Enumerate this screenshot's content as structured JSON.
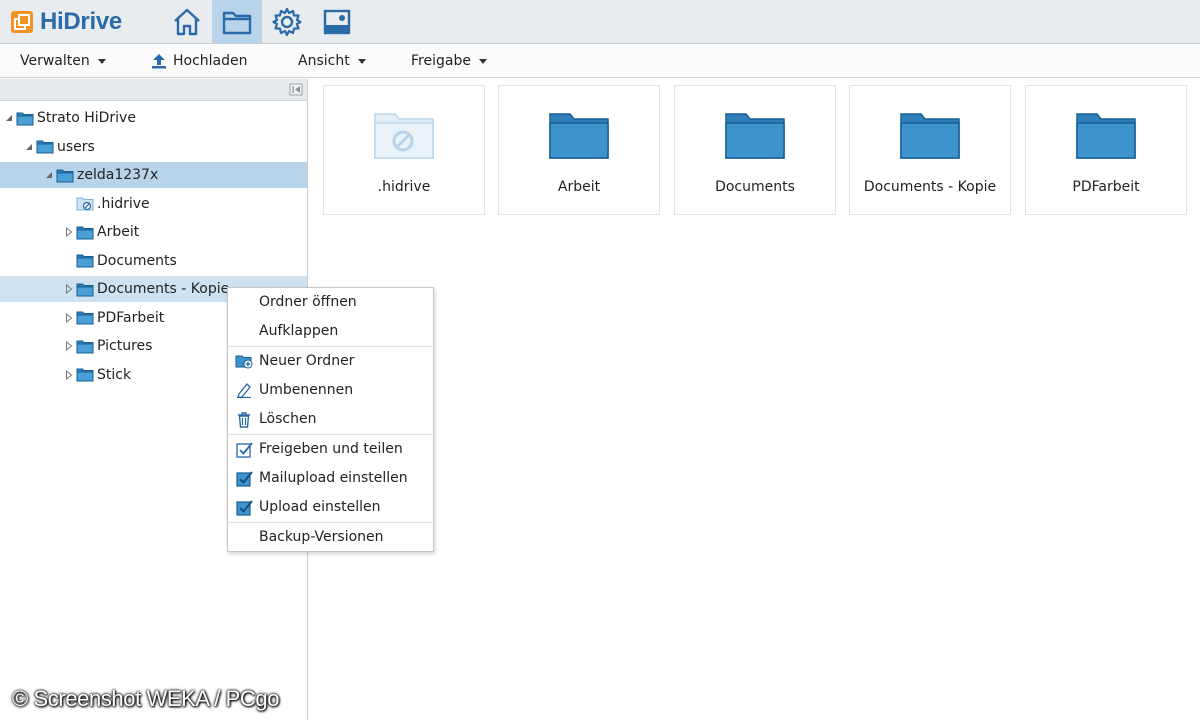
{
  "app": {
    "logo_text": "HiDrive",
    "accent_color": "#2b6aa8",
    "logo_color": "#f39323"
  },
  "nav": [
    {
      "icon": "home-icon",
      "active": false
    },
    {
      "icon": "folder-icon",
      "active": true
    },
    {
      "icon": "gear-icon",
      "active": false
    },
    {
      "icon": "picture-icon",
      "active": false
    }
  ],
  "toolbar": {
    "verwalten": "Verwalten",
    "hochladen": "Hochladen",
    "ansicht": "Ansicht",
    "freigabe": "Freigabe"
  },
  "tree": {
    "nodes": [
      {
        "label": "Strato HiDrive",
        "level": 0,
        "expanded": true,
        "state": "normal"
      },
      {
        "label": "users",
        "level": 1,
        "expanded": true,
        "state": "normal"
      },
      {
        "label": "zelda1237x",
        "level": 2,
        "expanded": true,
        "state": "selected"
      },
      {
        "label": ".hidrive",
        "level": 3,
        "expanded": false,
        "state": "normal",
        "icon": "hidden-folder-icon"
      },
      {
        "label": "Arbeit",
        "level": 3,
        "expanded": false,
        "state": "normal"
      },
      {
        "label": "Documents",
        "level": 3,
        "expanded": false,
        "state": "normal"
      },
      {
        "label": "Documents - Kopie",
        "level": 3,
        "expanded": false,
        "state": "hover"
      },
      {
        "label": "PDFarbeit",
        "level": 3,
        "expanded": false,
        "state": "normal"
      },
      {
        "label": "Pictures",
        "level": 3,
        "expanded": false,
        "state": "normal"
      },
      {
        "label": "Stick",
        "level": 3,
        "expanded": false,
        "state": "normal"
      }
    ]
  },
  "folders": [
    {
      "label": ".hidrive",
      "icon": "hidden-folder-icon"
    },
    {
      "label": "Arbeit",
      "icon": "folder-icon"
    },
    {
      "label": "Documents",
      "icon": "folder-icon"
    },
    {
      "label": "Documents - Kopie",
      "icon": "folder-icon"
    },
    {
      "label": "PDFarbeit",
      "icon": "folder-icon"
    }
  ],
  "context_menu": {
    "items": [
      {
        "label": "Ordner öffnen",
        "icon": ""
      },
      {
        "label": "Aufklappen",
        "icon": ""
      },
      {
        "label": "Neuer Ordner",
        "icon": "new-folder-icon"
      },
      {
        "label": "Umbenennen",
        "icon": "pencil-icon"
      },
      {
        "label": "Löschen",
        "icon": "trash-icon"
      },
      {
        "label": "Freigeben und teilen",
        "icon": "share-check-icon"
      },
      {
        "label": "Mailupload einstellen",
        "icon": "checkbox-icon"
      },
      {
        "label": "Upload einstellen",
        "icon": "checkbox-icon"
      },
      {
        "label": "Backup-Versionen",
        "icon": ""
      }
    ]
  },
  "watermark": "© Screenshot WEKA / PCgo"
}
